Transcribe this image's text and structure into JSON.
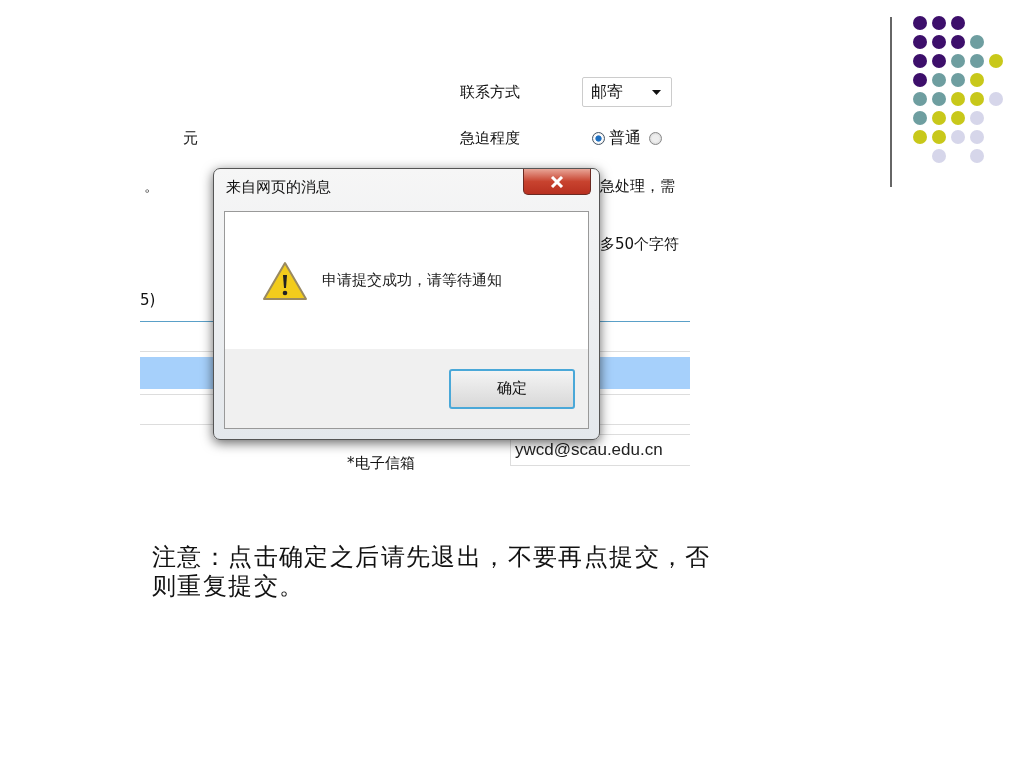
{
  "form": {
    "contact_method": {
      "label": "联系方式",
      "value": "邮寄"
    },
    "urgency": {
      "label": "急迫程度",
      "options": [
        {
          "label": "普通",
          "selected": true
        },
        {
          "selected": false
        }
      ]
    },
    "fragments": [
      "元",
      "。",
      "急处理，需",
      "多50个字符",
      "5)"
    ],
    "email": {
      "label": "*电子信箱",
      "value": "ywcd@scau.edu.cn"
    }
  },
  "dialog": {
    "title": "来自网页的消息",
    "message": "申请提交成功，请等待通知",
    "buttons": [
      "确定"
    ]
  },
  "note": "注意：点击确定之后请先退出，不要再点提交，否则重复提交。"
}
